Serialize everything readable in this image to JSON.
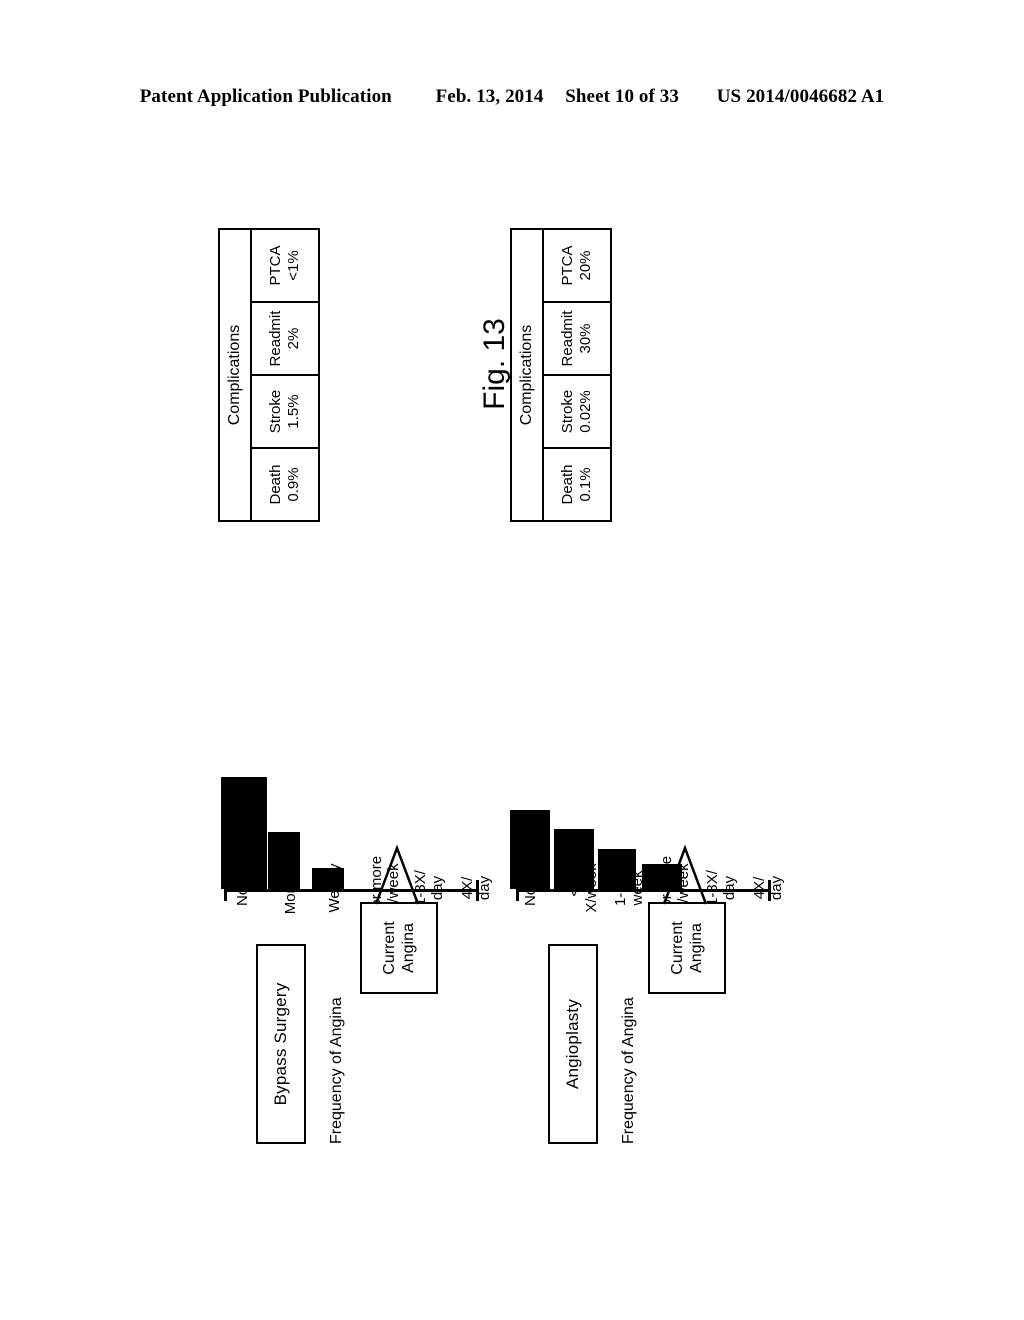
{
  "page_header": {
    "publication": "Patent Application Publication",
    "date": "Feb. 13, 2014",
    "sheet": "Sheet 10 of 33",
    "patent_number": "US 2014/0046682 A1"
  },
  "figure": {
    "caption": "Fig. 13"
  },
  "callout": {
    "line1": "Current",
    "line2": "Angina"
  },
  "panels": [
    {
      "title": "Bypass Surgery",
      "axis_title": "Frequency of Angina",
      "complications": {
        "header": "Complications",
        "cells": [
          {
            "label": "Death",
            "value": "0.9%"
          },
          {
            "label": "Stroke",
            "value": "1.5%"
          },
          {
            "label": "Readmit",
            "value": "2%"
          },
          {
            "label": "PTCA",
            "value": "<1%"
          }
        ]
      }
    },
    {
      "title": "Angioplasty",
      "axis_title": "Frequency of Angina",
      "complications": {
        "header": "Complications",
        "cells": [
          {
            "label": "Death",
            "value": "0.1%"
          },
          {
            "label": "Stroke",
            "value": "0.02%"
          },
          {
            "label": "Readmit",
            "value": "30%"
          },
          {
            "label": "PTCA",
            "value": "20%"
          }
        ]
      }
    }
  ],
  "chart_data": [
    {
      "type": "bar",
      "title": "Bypass Surgery",
      "xlabel": "Frequency of Angina",
      "ylabel": "",
      "orientation": "horizontal",
      "grid": false,
      "legend": "none",
      "annotations": [
        "Current Angina"
      ],
      "categories": [
        "4X/ day",
        "1-3X/ day",
        "3 or more X/week",
        "Weekly",
        "Monthly",
        "None"
      ],
      "category_lines": [
        [
          "4X/",
          "day"
        ],
        [
          "1-3X/",
          "day"
        ],
        [
          "3 or more",
          "X/week"
        ],
        [
          "Weekly",
          ""
        ],
        [
          "Monthly",
          ""
        ],
        [
          "None",
          ""
        ]
      ],
      "values": [
        0,
        0,
        0,
        18,
        48,
        94
      ],
      "ylim": [
        0,
        100
      ]
    },
    {
      "type": "bar",
      "title": "Angioplasty",
      "xlabel": "Frequency of Angina",
      "ylabel": "",
      "orientation": "horizontal",
      "grid": false,
      "legend": "none",
      "annotations": [
        "Current Angina"
      ],
      "categories": [
        "4X/ day",
        "1-3X/ day",
        "3 or more X/week",
        "1-2X/ week",
        "<1 X/week",
        "None"
      ],
      "category_lines": [
        [
          "4X/",
          "day"
        ],
        [
          "1-3X/",
          "day"
        ],
        [
          "3 or more",
          "X/week"
        ],
        [
          "1-2X/",
          "week"
        ],
        [
          "<1",
          "X/week"
        ],
        [
          "None",
          ""
        ]
      ],
      "values": [
        0,
        0,
        21,
        34,
        50,
        66
      ],
      "ylim": [
        0,
        100
      ]
    }
  ]
}
